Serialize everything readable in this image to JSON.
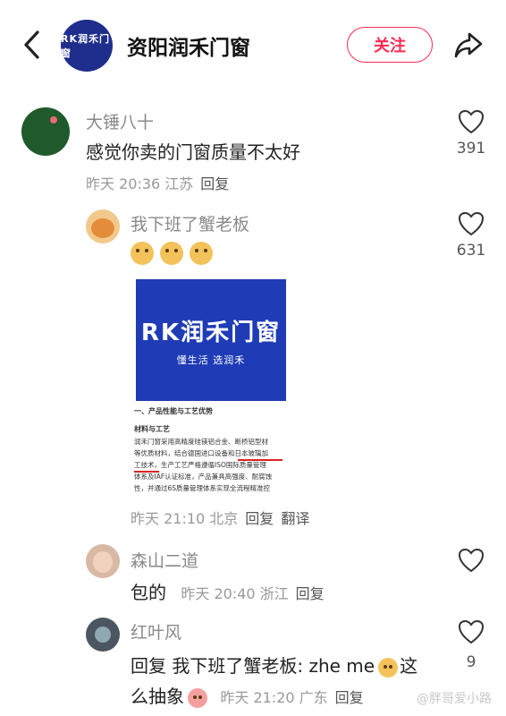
{
  "header": {
    "title": "资阳润禾门窗",
    "follow_label": "关注",
    "logo_text": "RK润禾门窗"
  },
  "comments": [
    {
      "name": "大锤八十",
      "text": "感觉你卖的门窗质量不太好",
      "time": "昨天 20:36 江苏",
      "reply_label": "回复",
      "likes": "391"
    },
    {
      "name": "我下班了蟹老板",
      "likes": "631",
      "time": "昨天 21:10 北京",
      "reply_label": "回复",
      "translate_label": "翻译",
      "image": {
        "brand": "RK润禾门窗",
        "slogan": "懂生活 选润禾",
        "lines": [
          "一、产品性能与工艺优势",
          "材料与工艺",
          "润禾门窗采用高精度硅镁铝合金、断桥铝型材",
          "等优质材料，结合德国进口设备和日本玻璃加",
          "工技术，生产工艺严格遵循ISO国际质量管理",
          "体系及IAF认证标准，产品兼具高强度、耐腐蚀",
          "性，并通过6S质量管理体系实现全流程精准控"
        ]
      }
    },
    {
      "name": "森山二道",
      "text": "包的",
      "time": "昨天 20:40 浙江",
      "reply_label": "回复",
      "likes": ""
    },
    {
      "name": "红叶风",
      "text_line1": "回复 我下班了蟹老板: zhe me",
      "text_line1_tail": "这",
      "text_line2": "么抽象",
      "time": "昨天 21:20 广东",
      "reply_label": "回复",
      "likes": "9"
    }
  ],
  "watermark": "@胖哥爱小路",
  "colors": {
    "accent": "#ff2b54",
    "brand_blue": "#1f3cb6"
  }
}
